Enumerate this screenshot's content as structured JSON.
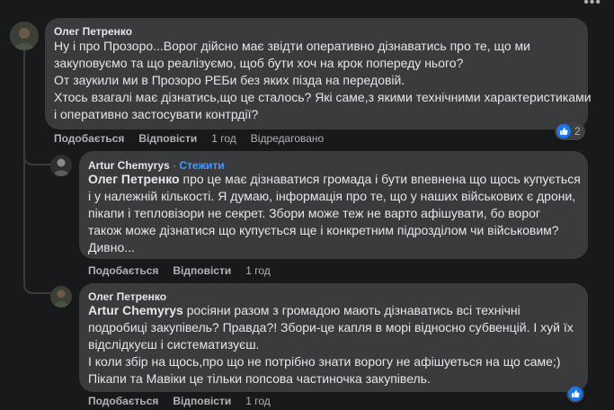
{
  "colors": {
    "background": "#18191a",
    "bubble": "#3a3b3c",
    "accent": "#4599ff",
    "like": "#1877f2"
  },
  "more_icon": "more-dots-icon",
  "comments": [
    {
      "author": "Олег Петренко",
      "lines": [
        "Ну і про Прозоро...Ворог дійсно має звідти оперативно дізнаватись про те, що ми",
        "закуповуємо та що реалізуємо, щоб бути хоч на крок попереду нього?",
        "От заукили ми в Прозоро РЕБи без яких пізда на передовій.",
        "Хтось взагалі має дізнатись,що це сталось? Які саме,з якими технічними характеристиками",
        "і оперативно застосувати контрдії?"
      ],
      "actions": {
        "like": "Подобається",
        "reply": "Відповісти",
        "time": "1 год",
        "edited": "Відредаговано"
      },
      "reaction_count": "2"
    },
    {
      "author": "Artur Chemyrys",
      "follow": "Стежити",
      "follow_sep": "·",
      "mention": "Олег Петренко",
      "first_line_rest": " про це має дізнаватися громада і бути впевнена що щось купується",
      "lines": [
        "і у належній кількості. Я думаю, інформація про те, що у наших військових є дрони,",
        "пікапи і тепловізори не секрет. Збори може теж не варто афішувати, бо ворог",
        "також може дізнатися що купується ще і конкретним підрозділом чи військовим?",
        "Дивно..."
      ],
      "actions": {
        "like": "Подобається",
        "reply": "Відповісти",
        "time": "1 год"
      }
    },
    {
      "author": "Олег Петренко",
      "mention": "Artur Chemyrys",
      "first_line_rest": " росіяни разом з громадою мають дізнаватись всі технічні",
      "lines": [
        "подробиці закупівель? Правда?! Збори-це капля в морі відносно субвенцій. І хуй їх",
        "відслідкуєш і систематизуєш.",
        "І коли збір на щось,про що не потрібно знати ворогу не афішуеться на що саме;)",
        "Пікапи та Мавіки це тільки попсова частиночка закупівель."
      ],
      "actions": {
        "like": "Подобається",
        "reply": "Відповісти",
        "time": "1 год"
      }
    }
  ]
}
